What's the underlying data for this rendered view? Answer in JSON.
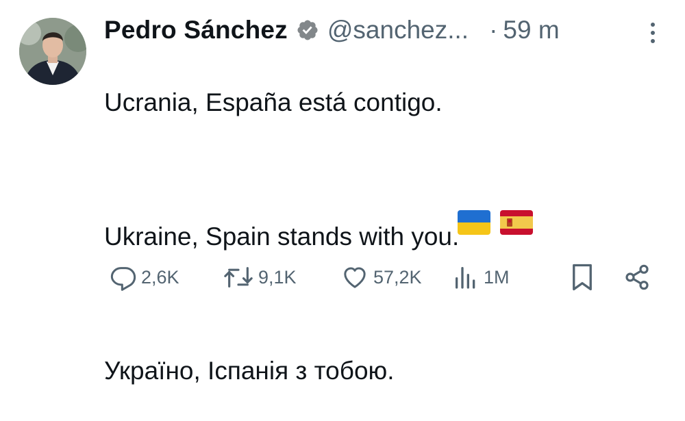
{
  "user": {
    "name": "Pedro Sánchez",
    "handle": "@sanchez...",
    "separator": "·",
    "time": "59 m"
  },
  "tweet": {
    "lines": [
      "Ucrania, España está contigo.",
      "",
      "Ukraine, Spain stands with you.",
      "",
      "Україно, Іспанія з тобою."
    ],
    "emojis": [
      "flag-ukraine",
      "flag-spain"
    ]
  },
  "actions": {
    "replies": "2,6K",
    "reposts": "9,1K",
    "likes": "57,2K",
    "views": "1M"
  },
  "colors": {
    "text": "#0f1419",
    "secondary": "#536471",
    "verified_badge": "#82878a",
    "ukraine_blue": "#1f6fd1",
    "ukraine_yellow": "#f5c518",
    "spain_red": "#c8102e",
    "spain_yellow": "#f2c94c"
  }
}
